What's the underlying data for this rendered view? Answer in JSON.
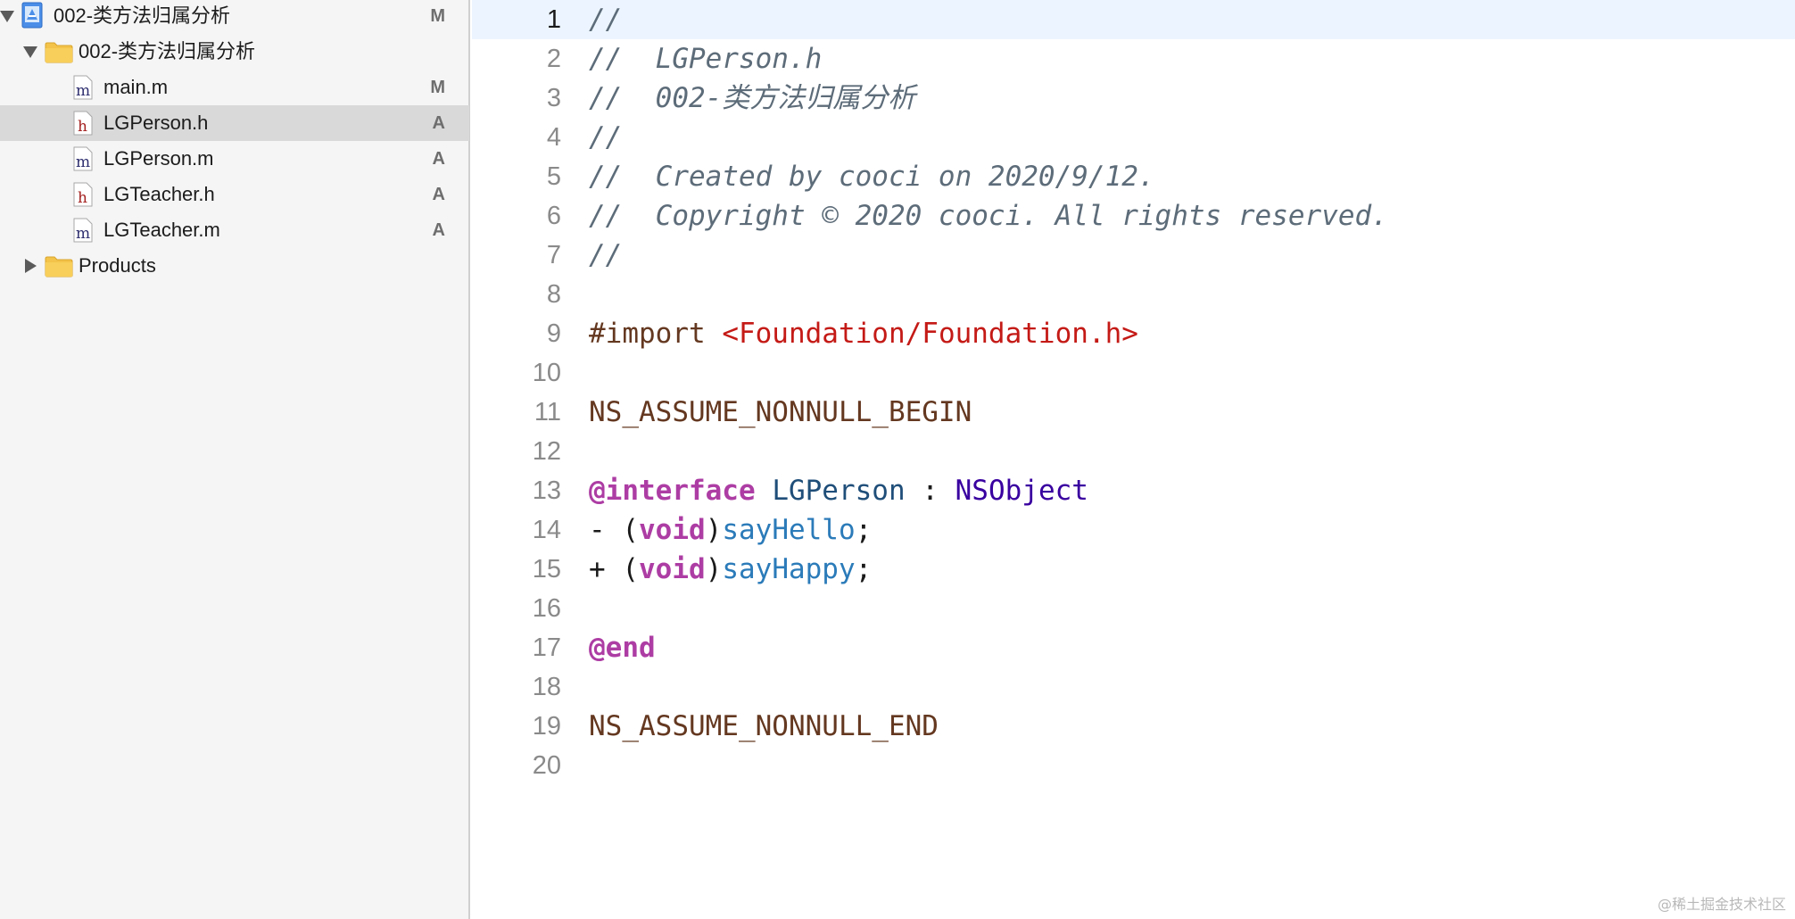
{
  "navigator": {
    "items": [
      {
        "label": "002-类方法归属分析",
        "badge": "M",
        "icon": "project-icon",
        "disclosure": "expanded"
      },
      {
        "label": "002-类方法归属分析",
        "badge": "",
        "icon": "folder-icon",
        "disclosure": "expanded"
      },
      {
        "label": "main.m",
        "badge": "M",
        "icon": "objc-source-file-icon"
      },
      {
        "label": "LGPerson.h",
        "badge": "A",
        "icon": "header-file-icon",
        "selected": true
      },
      {
        "label": "LGPerson.m",
        "badge": "A",
        "icon": "objc-source-file-icon"
      },
      {
        "label": "LGTeacher.h",
        "badge": "A",
        "icon": "header-file-icon"
      },
      {
        "label": "LGTeacher.m",
        "badge": "A",
        "icon": "objc-source-file-icon"
      },
      {
        "label": "Products",
        "badge": "",
        "icon": "folder-icon",
        "disclosure": "collapsed"
      }
    ],
    "icon_glyphs": {
      "header": "h",
      "source": "m"
    }
  },
  "editor": {
    "current_line": 1,
    "lines": [
      {
        "n": "1",
        "tokens": [
          {
            "t": "//",
            "c": "comment"
          }
        ]
      },
      {
        "n": "2",
        "tokens": [
          {
            "t": "//  LGPerson.h",
            "c": "comment"
          }
        ]
      },
      {
        "n": "3",
        "tokens": [
          {
            "t": "//  002-类方法归属分析",
            "c": "comment"
          }
        ]
      },
      {
        "n": "4",
        "tokens": [
          {
            "t": "//",
            "c": "comment"
          }
        ]
      },
      {
        "n": "5",
        "tokens": [
          {
            "t": "//  Created by cooci on 2020/9/12.",
            "c": "comment"
          }
        ]
      },
      {
        "n": "6",
        "tokens": [
          {
            "t": "//  Copyright © 2020 cooci. All rights reserved.",
            "c": "comment"
          }
        ]
      },
      {
        "n": "7",
        "tokens": [
          {
            "t": "//",
            "c": "comment"
          }
        ]
      },
      {
        "n": "8",
        "tokens": []
      },
      {
        "n": "9",
        "tokens": [
          {
            "t": "#import ",
            "c": "preproc"
          },
          {
            "t": "<Foundation/Foundation.h>",
            "c": "string"
          }
        ]
      },
      {
        "n": "10",
        "tokens": []
      },
      {
        "n": "11",
        "tokens": [
          {
            "t": "NS_ASSUME_NONNULL_BEGIN",
            "c": "macro"
          }
        ]
      },
      {
        "n": "12",
        "tokens": []
      },
      {
        "n": "13",
        "tokens": [
          {
            "t": "@interface",
            "c": "keyword"
          },
          {
            "t": " ",
            "c": "plain"
          },
          {
            "t": "LGPerson",
            "c": "type"
          },
          {
            "t": " : ",
            "c": "plain"
          },
          {
            "t": "NSObject",
            "c": "class"
          }
        ]
      },
      {
        "n": "14",
        "tokens": [
          {
            "t": "- (",
            "c": "plain"
          },
          {
            "t": "void",
            "c": "keyword"
          },
          {
            "t": ")",
            "c": "plain"
          },
          {
            "t": "sayHello",
            "c": "method"
          },
          {
            "t": ";",
            "c": "plain"
          }
        ]
      },
      {
        "n": "15",
        "tokens": [
          {
            "t": "+ (",
            "c": "plain"
          },
          {
            "t": "void",
            "c": "keyword"
          },
          {
            "t": ")",
            "c": "plain"
          },
          {
            "t": "sayHappy",
            "c": "method"
          },
          {
            "t": ";",
            "c": "plain"
          }
        ]
      },
      {
        "n": "16",
        "tokens": []
      },
      {
        "n": "17",
        "tokens": [
          {
            "t": "@end",
            "c": "keyword"
          }
        ]
      },
      {
        "n": "18",
        "tokens": []
      },
      {
        "n": "19",
        "tokens": [
          {
            "t": "NS_ASSUME_NONNULL_END",
            "c": "macro"
          }
        ]
      },
      {
        "n": "20",
        "tokens": []
      }
    ]
  },
  "watermark": "@稀土掘金技术社区",
  "colors": {
    "comment": "#5d6c79",
    "keyword": "#ad3da4",
    "string": "#c41a16",
    "macro": "#643820",
    "class": "#3900a0",
    "type": "#1f4e79",
    "method": "#2b7bb9",
    "current_line_bg": "#ecf5ff",
    "selected_row_bg": "#d9d9d9"
  }
}
